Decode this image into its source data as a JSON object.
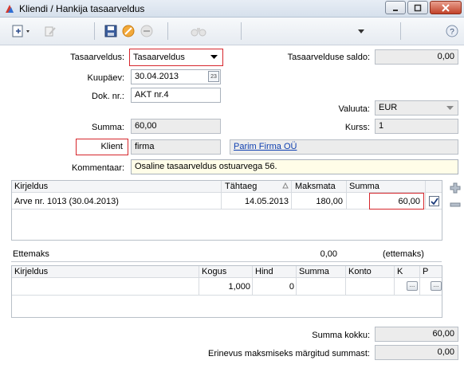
{
  "window": {
    "title": "Kliendi / Hankija tasaarveldus"
  },
  "form": {
    "tasaarveldus_label": "Tasaarveldus:",
    "tasaarveldus_value": "Tasaarveldus",
    "saldo_label": "Tasaarvelduse saldo:",
    "saldo_value": "0,00",
    "kuupaev_label": "Kuupäev:",
    "kuupaev_value": "30.04.2013",
    "dok_label": "Dok. nr.:",
    "dok_value": "AKT nr.4",
    "valuuta_label": "Valuuta:",
    "valuuta_value": "EUR",
    "summa_label": "Summa:",
    "summa_value": "60,00",
    "kurss_label": "Kurss:",
    "kurss_value": "1",
    "klient_label": "Klient",
    "klient_value": "firma",
    "klient_name": "Parim Firma OÜ",
    "kommentaar_label": "Kommentaar:",
    "kommentaar_value": "Osaline tasaarveldus ostuarvega 56."
  },
  "invoices": {
    "columns": [
      "Kirjeldus",
      "Tähtaeg",
      "Maksmata",
      "Summa"
    ],
    "rows": [
      {
        "kirjeldus": "Arve nr. 1013 (30.04.2013)",
        "tahtaeg": "14.05.2013",
        "maksmata": "180,00",
        "summa": "60,00",
        "checked": true
      }
    ]
  },
  "prepayment": {
    "label": "Ettemaks",
    "value": "0,00",
    "note": "(ettemaks)"
  },
  "items": {
    "columns": [
      "Kirjeldus",
      "Kogus",
      "Hind",
      "Summa",
      "Konto",
      "K",
      "P"
    ],
    "rows": [
      {
        "kirjeldus": "",
        "kogus": "1,000",
        "hind": "0",
        "summa": "",
        "konto": ""
      }
    ]
  },
  "totals": {
    "kokku_label": "Summa kokku:",
    "kokku_value": "60,00",
    "erinevus_label": "Erinevus maksmiseks märgitud summast:",
    "erinevus_value": "0,00"
  }
}
